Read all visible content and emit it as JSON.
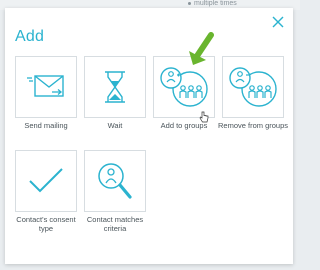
{
  "background": {
    "hint_text": "multiple times"
  },
  "modal": {
    "title": "Add",
    "close_icon": "close-icon",
    "accent_color": "#2bb3cf",
    "arrow_color": "#69b52e"
  },
  "tiles": [
    {
      "label": "Send mailing",
      "icon": "envelope-icon"
    },
    {
      "label": "Wait",
      "icon": "hourglass-icon"
    },
    {
      "label": "Add to groups",
      "icon": "add-group-icon"
    },
    {
      "label": "Remove from groups",
      "icon": "remove-group-icon"
    },
    {
      "label": "Contact's consent type",
      "icon": "checkmark-icon"
    },
    {
      "label": "Contact matches criteria",
      "icon": "person-search-icon"
    }
  ]
}
